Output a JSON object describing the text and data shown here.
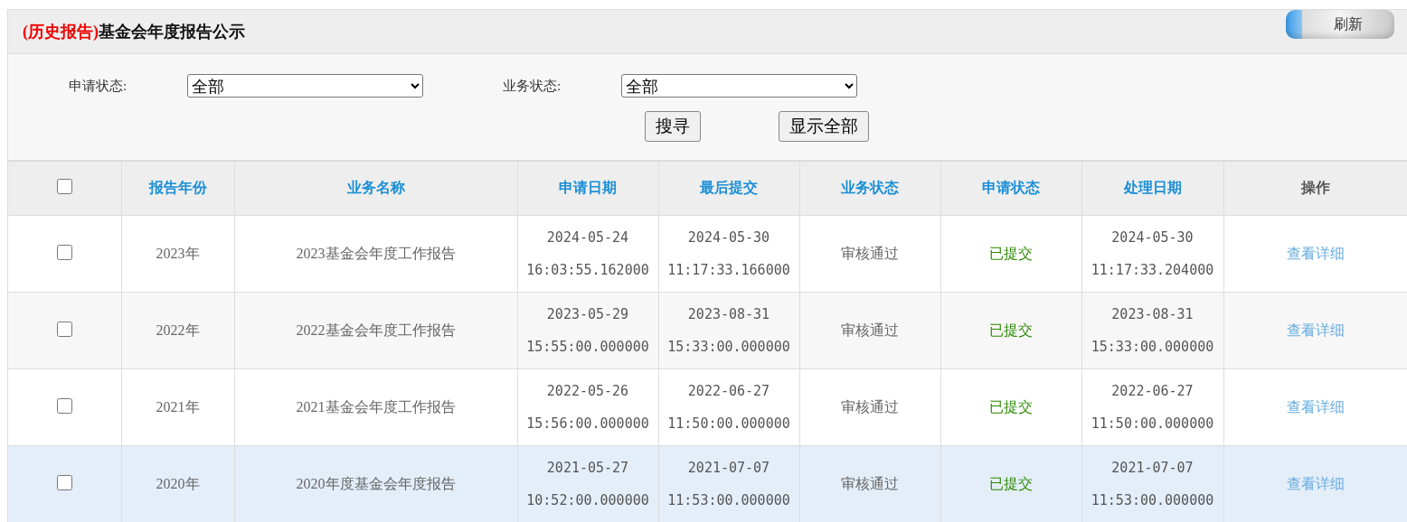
{
  "panel": {
    "title_tag": "(历史报告)",
    "title": "基金会年度报告公示",
    "refresh_button": "刷新"
  },
  "filters": [
    {
      "label": "申请状态:",
      "value": "全部"
    },
    {
      "label": "业务状态:",
      "value": "全部"
    }
  ],
  "buttons": [
    "搜寻",
    "显示全部"
  ],
  "table": {
    "select_all": {
      "checked": false
    },
    "columns": [
      {
        "label": "报告年份",
        "sortable": true
      },
      {
        "label": "业务名称",
        "sortable": true
      },
      {
        "label": "申请日期",
        "sortable": true
      },
      {
        "label": "最后提交",
        "sortable": true
      },
      {
        "label": "业务状态",
        "sortable": true
      },
      {
        "label": "申请状态",
        "sortable": true
      },
      {
        "label": "处理日期",
        "sortable": true
      },
      {
        "label": "操作",
        "sortable": false
      }
    ],
    "rows": [
      {
        "checked": false,
        "highlighted": false,
        "year": "2023年",
        "name": "2023基金会年度工作报告",
        "applied": "2024-05-24 16:03:55.162000",
        "last_submit": "2024-05-30 11:17:33.166000",
        "business_status": "审核通过",
        "apply_status": "已提交",
        "processed": "2024-05-30 11:17:33.204000",
        "action": "查看详细"
      },
      {
        "checked": false,
        "highlighted": false,
        "year": "2022年",
        "name": "2022基金会年度工作报告",
        "applied": "2023-05-29 15:55:00.000000",
        "last_submit": "2023-08-31 15:33:00.000000",
        "business_status": "审核通过",
        "apply_status": "已提交",
        "processed": "2023-08-31 15:33:00.000000",
        "action": "查看详细"
      },
      {
        "checked": false,
        "highlighted": false,
        "year": "2021年",
        "name": "2021基金会年度工作报告",
        "applied": "2022-05-26 15:56:00.000000",
        "last_submit": "2022-06-27 11:50:00.000000",
        "business_status": "审核通过",
        "apply_status": "已提交",
        "processed": "2022-06-27 11:50:00.000000",
        "action": "查看详细"
      },
      {
        "checked": false,
        "highlighted": true,
        "year": "2020年",
        "name": "2020年度基金会年度报告",
        "applied": "2021-05-27 10:52:00.000000",
        "last_submit": "2021-07-07 11:53:00.000000",
        "business_status": "审核通过",
        "apply_status": "已提交",
        "processed": "2021-07-07 11:53:00.000000",
        "action": "查看详细"
      }
    ]
  }
}
